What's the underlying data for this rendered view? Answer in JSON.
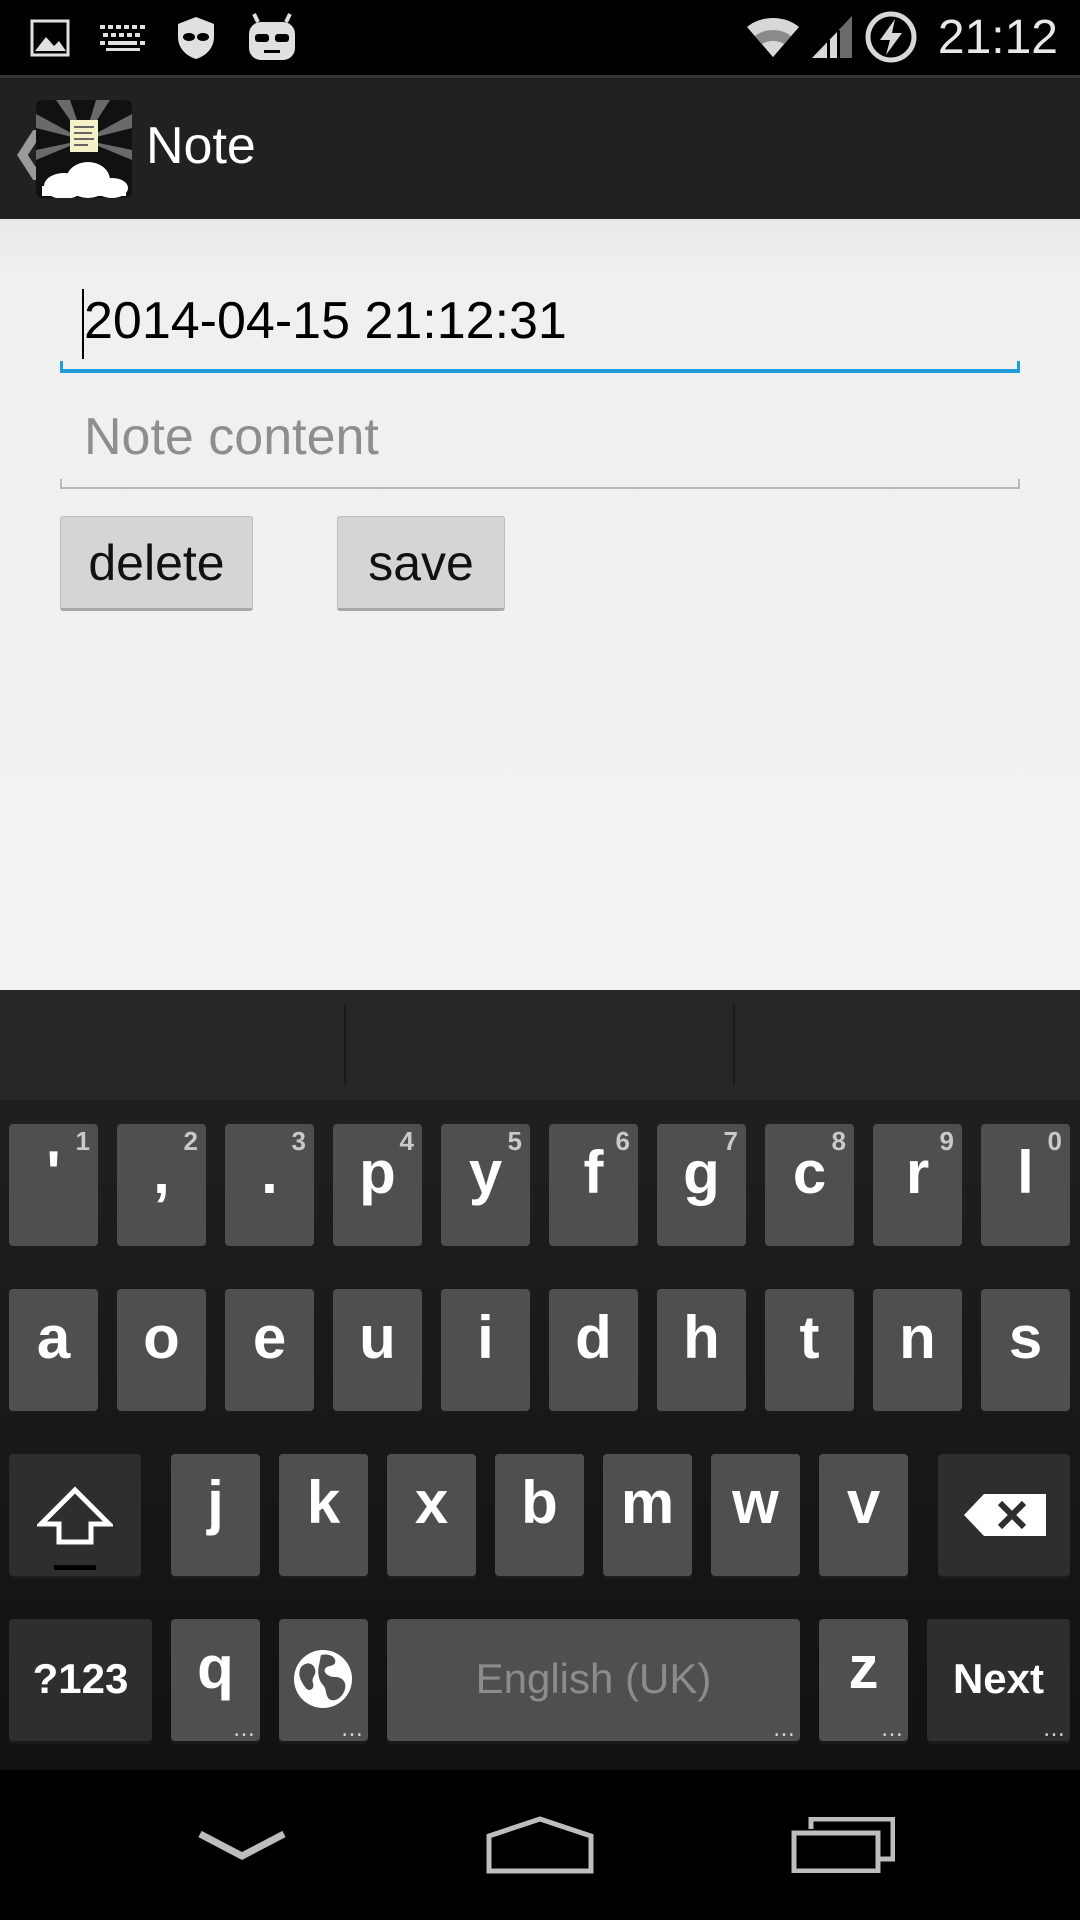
{
  "status_bar": {
    "time": "21:12",
    "left_icons": [
      "image-icon",
      "keyboard-icon",
      "shield-icon",
      "cyanogen-mascot-icon"
    ],
    "right_icons": [
      "wifi-icon",
      "signal-icon",
      "battery-charging-icon"
    ]
  },
  "action_bar": {
    "title": "Note",
    "back_glyph": "❮"
  },
  "form": {
    "title_value": "2014-04-15 21:12:31",
    "content_placeholder": "Note content",
    "delete_label": "delete",
    "save_label": "save"
  },
  "keyboard": {
    "row1": [
      {
        "ch": "'",
        "num": "1"
      },
      {
        "ch": ",",
        "num": "2"
      },
      {
        "ch": ".",
        "num": "3"
      },
      {
        "ch": "p",
        "num": "4"
      },
      {
        "ch": "y",
        "num": "5"
      },
      {
        "ch": "f",
        "num": "6"
      },
      {
        "ch": "g",
        "num": "7"
      },
      {
        "ch": "c",
        "num": "8"
      },
      {
        "ch": "r",
        "num": "9"
      },
      {
        "ch": "l",
        "num": "0"
      }
    ],
    "row2": [
      "a",
      "o",
      "e",
      "u",
      "i",
      "d",
      "h",
      "t",
      "n",
      "s"
    ],
    "row3": [
      "j",
      "k",
      "x",
      "b",
      "m",
      "w",
      "v"
    ],
    "symbols_label": "?123",
    "q_key": "q",
    "space_label": "English (UK)",
    "z_key": "z",
    "next_label": "Next",
    "more_dots": "…"
  },
  "colors": {
    "accent": "#1e9bd8",
    "action_bar": "#212121",
    "content_bg": "#f2f2f2",
    "key_bg": "#4f4f4f"
  }
}
